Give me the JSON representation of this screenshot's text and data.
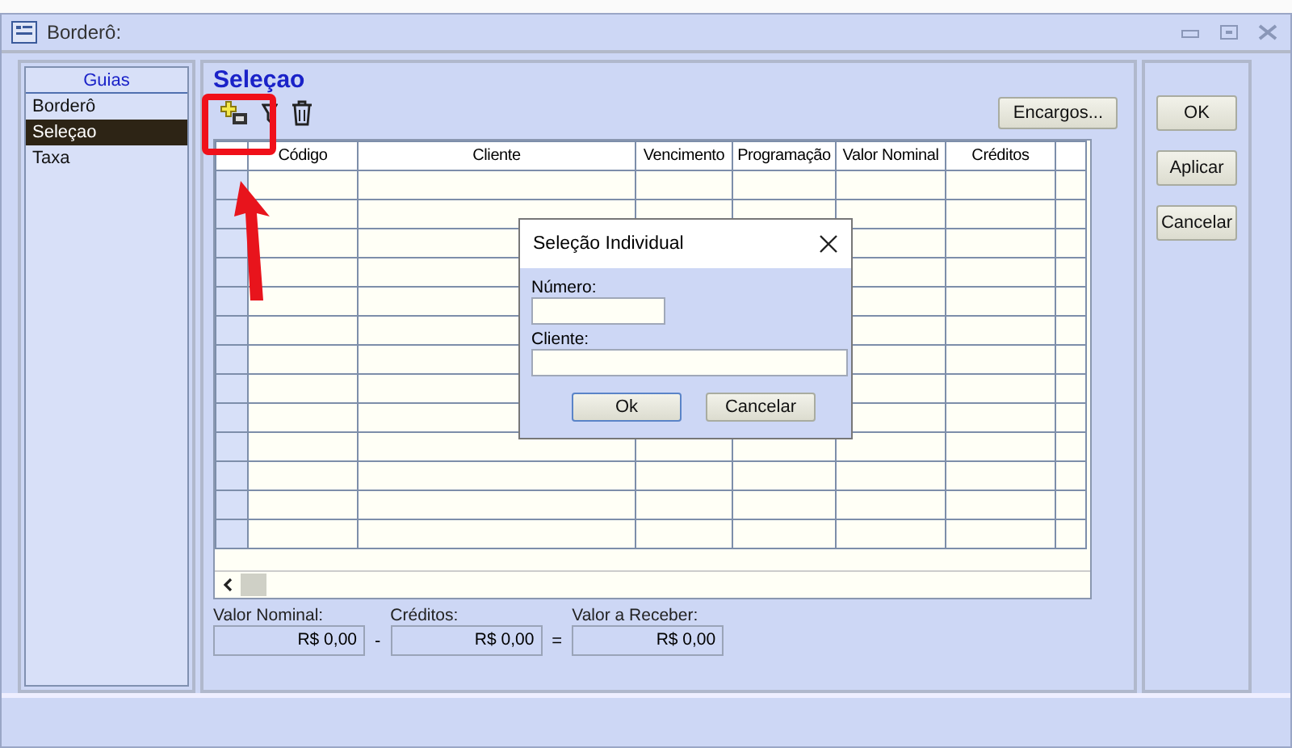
{
  "window": {
    "title": "Borderô:"
  },
  "sidebar": {
    "header": "Guias",
    "items": [
      {
        "label": "Borderô",
        "selected": false
      },
      {
        "label": "Seleçao",
        "selected": true
      },
      {
        "label": "Taxa",
        "selected": false
      }
    ]
  },
  "section_title": "Seleçao",
  "encargos_button": "Encargos...",
  "table": {
    "columns": [
      "Código",
      "Cliente",
      "Vencimento",
      "Programação",
      "Valor Nominal",
      "Créditos"
    ]
  },
  "totals": [
    {
      "label": "Valor Nominal:",
      "value": "R$ 0,00",
      "operator": "-"
    },
    {
      "label": "Créditos:",
      "value": "R$ 0,00",
      "operator": "="
    },
    {
      "label": "Valor a Receber:",
      "value": "R$ 0,00"
    }
  ],
  "side_buttons": [
    "OK",
    "Aplicar",
    "Cancelar"
  ],
  "dialog": {
    "title": "Seleção Individual",
    "fields": [
      {
        "label": "Número:"
      },
      {
        "label": "Cliente:"
      }
    ],
    "buttons": [
      "Ok",
      "Cancelar"
    ]
  }
}
